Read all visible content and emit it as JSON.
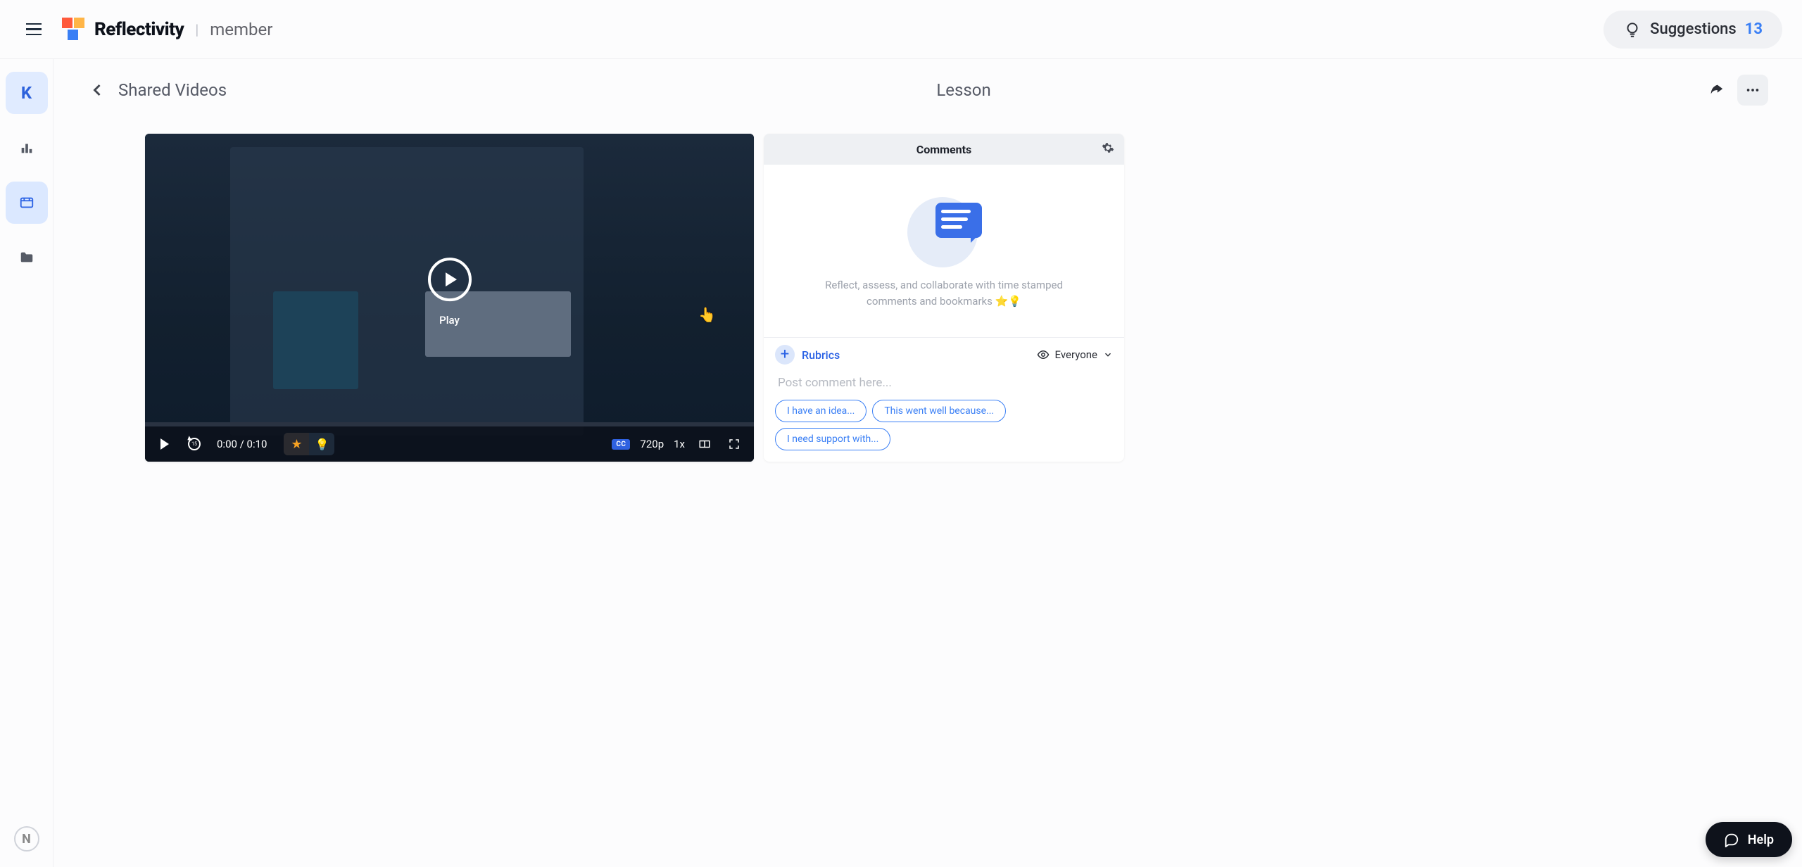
{
  "header": {
    "brand": "Reflectivity",
    "role": "member",
    "suggestions_label": "Suggestions",
    "suggestions_count": "13"
  },
  "left_nav": {
    "avatar_initial": "K"
  },
  "page": {
    "back_label": "Shared Videos",
    "title": "Lesson"
  },
  "video": {
    "play_label": "Play",
    "rewind_seconds": "15",
    "time_display": "0:00 / 0:10",
    "cc_label": "CC",
    "quality": "720p",
    "speed": "1x"
  },
  "comments": {
    "title": "Comments",
    "empty_text": "Reflect, assess, and collaborate with time stamped comments and bookmarks ⭐💡",
    "rubrics_label": "Rubrics",
    "visibility_label": "Everyone",
    "input_placeholder": "Post comment here...",
    "prompts": {
      "idea": "I have an idea...",
      "well": "This went well because...",
      "support": "I need support with..."
    }
  },
  "help": {
    "label": "Help"
  }
}
